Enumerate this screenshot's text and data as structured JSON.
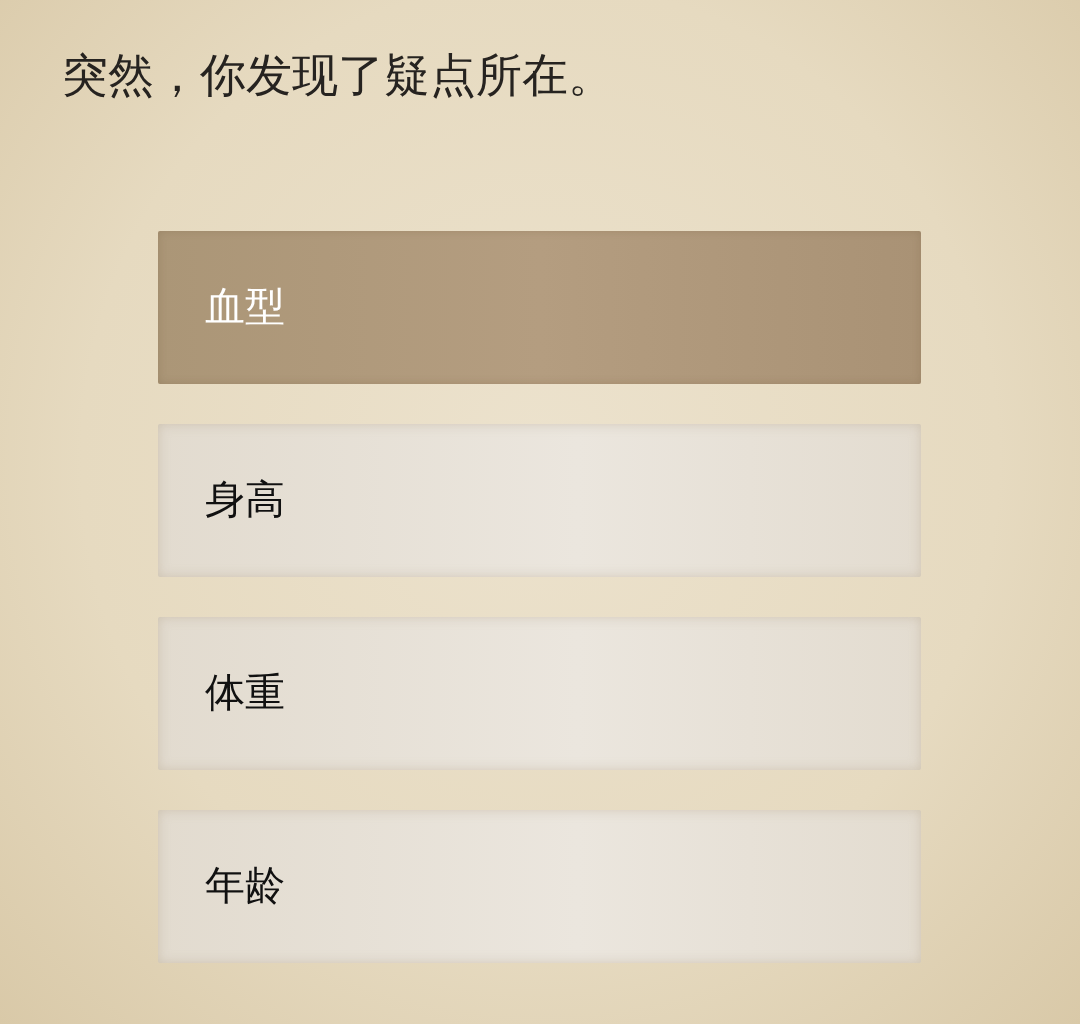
{
  "prompt": "突然，你发现了疑点所在。",
  "options": [
    {
      "label": "血型",
      "selected": true
    },
    {
      "label": "身高",
      "selected": false
    },
    {
      "label": "体重",
      "selected": false
    },
    {
      "label": "年龄",
      "selected": false
    }
  ]
}
